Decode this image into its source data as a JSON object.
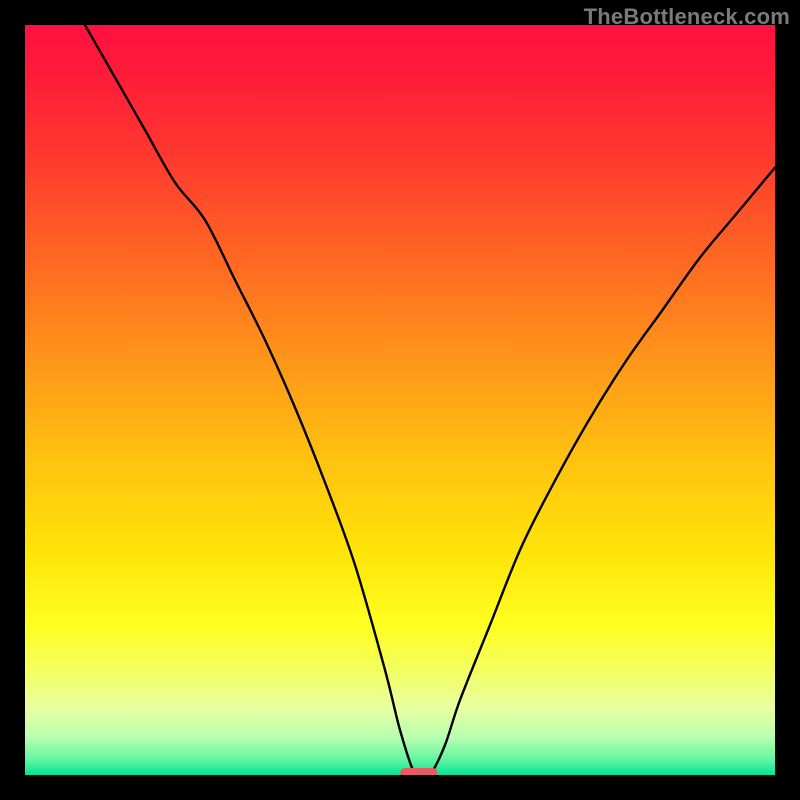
{
  "attribution": "TheBottleneck.com",
  "chart_data": {
    "type": "line",
    "title": "",
    "xlabel": "",
    "ylabel": "",
    "xlim": [
      0,
      100
    ],
    "ylim": [
      0,
      100
    ],
    "x": [
      8,
      12,
      16,
      20,
      24,
      28,
      32,
      36,
      40,
      44,
      48,
      50,
      52,
      53,
      54,
      56,
      58,
      62,
      66,
      70,
      75,
      80,
      85,
      90,
      95,
      100
    ],
    "values": [
      100,
      93,
      86,
      79,
      74,
      66,
      58,
      49,
      39,
      28,
      14,
      6,
      0,
      0,
      0,
      4,
      10,
      20,
      30,
      38,
      47,
      55,
      62,
      69,
      75,
      81
    ],
    "marker": {
      "x_center": 52.5,
      "y": 0,
      "width": 5,
      "height": 1.2
    },
    "gradient_stops": [
      {
        "offset": 0.0,
        "color": "#ff1040"
      },
      {
        "offset": 0.06,
        "color": "#ff1a3a"
      },
      {
        "offset": 0.18,
        "color": "#ff3a2e"
      },
      {
        "offset": 0.32,
        "color": "#ff6a22"
      },
      {
        "offset": 0.46,
        "color": "#ff9a18"
      },
      {
        "offset": 0.58,
        "color": "#ffc210"
      },
      {
        "offset": 0.7,
        "color": "#ffe308"
      },
      {
        "offset": 0.8,
        "color": "#ffff20"
      },
      {
        "offset": 0.86,
        "color": "#f3ff60"
      },
      {
        "offset": 0.91,
        "color": "#e8ffa0"
      },
      {
        "offset": 0.95,
        "color": "#b8ffb0"
      },
      {
        "offset": 0.98,
        "color": "#60f5a0"
      },
      {
        "offset": 1.0,
        "color": "#00e49a"
      }
    ],
    "line_color": "#000000",
    "marker_color": "#e35d62"
  }
}
